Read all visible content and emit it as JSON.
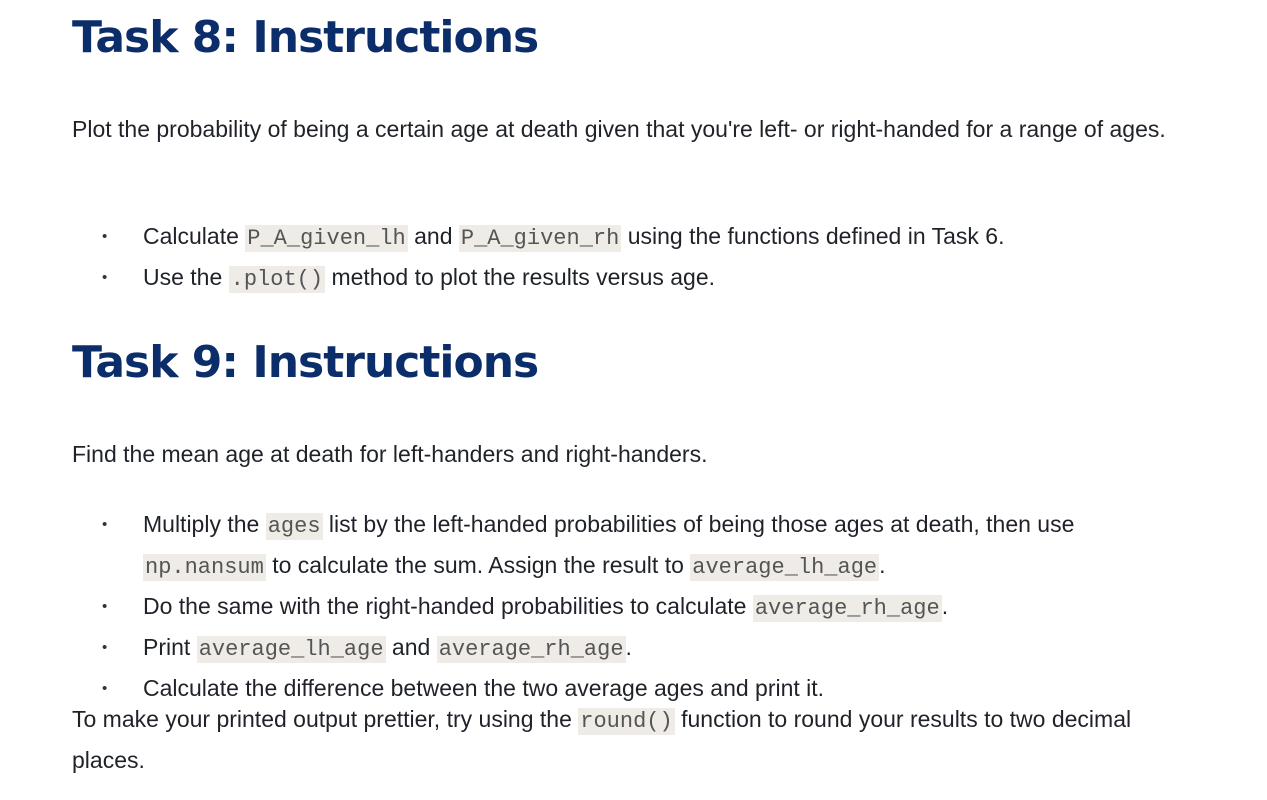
{
  "task8": {
    "heading": "Task 8: Instructions",
    "intro": "Plot the probability of being a certain age at death given that you're left- or right-handed for a range of ages.",
    "bullets": [
      {
        "t1": "Calculate ",
        "c1": "P_A_given_lh",
        "t2": " and ",
        "c2": "P_A_given_rh",
        "t3": " using the functions defined in Task 6."
      },
      {
        "t1": "Use the ",
        "c1": ".plot()",
        "t2": " method to plot the results versus age."
      }
    ]
  },
  "task9": {
    "heading": "Task 9: Instructions",
    "intro": "Find the mean age at death for left-handers and right-handers.",
    "bullets": [
      {
        "t1": "Multiply the ",
        "c1": "ages",
        "t2": " list by the left-handed probabilities of being those ages at death, then use ",
        "c2": "np.nansum",
        "t3": " to calculate the sum. Assign the result to ",
        "c3": "average_lh_age",
        "t4": "."
      },
      {
        "t1": "Do the same with the right-handed probabilities to calculate ",
        "c1": "average_rh_age",
        "t2": "."
      },
      {
        "t1": "Print ",
        "c1": "average_lh_age",
        "t2": " and ",
        "c2": "average_rh_age",
        "t3": "."
      },
      {
        "t1": "Calculate the difference between the two average ages and print it."
      }
    ],
    "tip": {
      "t1": "To make your printed output prettier, try using the ",
      "c1": "round()",
      "t2": " function to round your results to two decimal places."
    }
  },
  "bullet_glyph": "•"
}
